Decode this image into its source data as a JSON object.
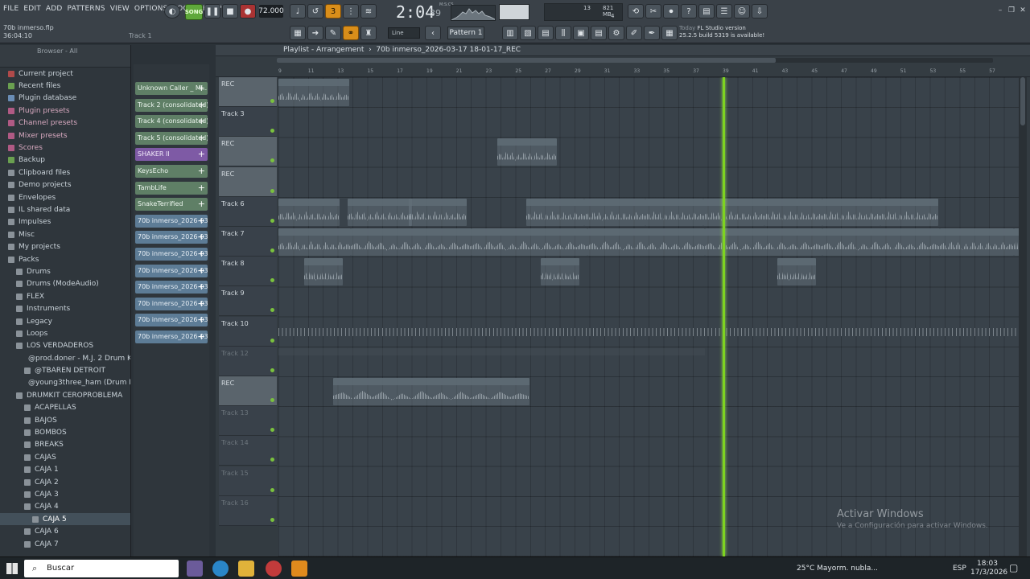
{
  "menu": [
    "FILE",
    "EDIT",
    "ADD",
    "PATTERNS",
    "VIEW",
    "OPTIONS",
    "TOOLS",
    "HELP"
  ],
  "project_file": "70b inmerso.flp",
  "project_time": "36:04:10",
  "track_hint": "Track 1",
  "song_mode": "SONG",
  "tempo": "72.000",
  "time": "2:04",
  "time_frac": "39",
  "time_unit": "M:S:CS",
  "cpu": {
    "cores": "13",
    "mem": "821 MB",
    "poly": "4"
  },
  "snap": "Line",
  "pattern": "Pattern 1",
  "news": {
    "label": "Today",
    "title": "FL Studio version",
    "body": "25.2.5 build 5319 is available!"
  },
  "browser": {
    "title": "Browser - All",
    "items": [
      {
        "label": "Current project",
        "kind": "red",
        "indent": 0
      },
      {
        "label": "Recent files",
        "kind": "green",
        "indent": 0
      },
      {
        "label": "Plugin database",
        "kind": "blue",
        "indent": 0
      },
      {
        "label": "Plugin presets",
        "kind": "pink",
        "indent": 0
      },
      {
        "label": "Channel presets",
        "kind": "pink",
        "indent": 0
      },
      {
        "label": "Mixer presets",
        "kind": "pink",
        "indent": 0
      },
      {
        "label": "Scores",
        "kind": "pink",
        "indent": 0
      },
      {
        "label": "Backup",
        "kind": "green",
        "indent": 0
      },
      {
        "label": "Clipboard files",
        "kind": "folder",
        "indent": 0
      },
      {
        "label": "Demo projects",
        "kind": "folder",
        "indent": 0
      },
      {
        "label": "Envelopes",
        "kind": "folder",
        "indent": 0
      },
      {
        "label": "IL shared data",
        "kind": "folder",
        "indent": 0
      },
      {
        "label": "Impulses",
        "kind": "folder",
        "indent": 0
      },
      {
        "label": "Misc",
        "kind": "folder",
        "indent": 0
      },
      {
        "label": "My projects",
        "kind": "folder",
        "indent": 0
      },
      {
        "label": "Packs",
        "kind": "folder",
        "indent": 0
      },
      {
        "label": "Drums",
        "kind": "folder",
        "indent": 1
      },
      {
        "label": "Drums (ModeAudio)",
        "kind": "folder",
        "indent": 1
      },
      {
        "label": "FLEX",
        "kind": "folder",
        "indent": 1
      },
      {
        "label": "Instruments",
        "kind": "folder",
        "indent": 1
      },
      {
        "label": "Legacy",
        "kind": "folder",
        "indent": 1
      },
      {
        "label": "Loops",
        "kind": "folder",
        "indent": 1
      },
      {
        "label": "LOS VERDADEROS",
        "kind": "folder",
        "indent": 1
      },
      {
        "label": "@prod.doner - M.J. 2 Drum Kit",
        "kind": "folder",
        "indent": 2
      },
      {
        "label": "@TBAREN DETROIT",
        "kind": "folder",
        "indent": 2
      },
      {
        "label": "@young3three_ham (Drum Kit)",
        "kind": "folder",
        "indent": 2
      },
      {
        "label": "DRUMKIT CEROPROBLEMA",
        "kind": "folder",
        "indent": 1
      },
      {
        "label": "ACAPELLAS",
        "kind": "folder",
        "indent": 2
      },
      {
        "label": "BAJOS",
        "kind": "folder",
        "indent": 2
      },
      {
        "label": "BOMBOS",
        "kind": "folder",
        "indent": 2
      },
      {
        "label": "BREAKS",
        "kind": "folder",
        "indent": 2
      },
      {
        "label": "CAJAS",
        "kind": "folder",
        "indent": 2
      },
      {
        "label": "CAJA 1",
        "kind": "folder",
        "indent": 2
      },
      {
        "label": "CAJA 2",
        "kind": "folder",
        "indent": 2
      },
      {
        "label": "CAJA 3",
        "kind": "folder",
        "indent": 2
      },
      {
        "label": "CAJA 4",
        "kind": "folder",
        "indent": 2
      },
      {
        "label": "CAJA 5",
        "kind": "folder",
        "indent": 3
      },
      {
        "label": "CAJA 6",
        "kind": "folder",
        "indent": 2
      },
      {
        "label": "CAJA 7",
        "kind": "folder",
        "indent": 2
      }
    ]
  },
  "channels": [
    {
      "label": "Unknown Caller _ Mi...",
      "color": "green"
    },
    {
      "label": "Track 2 (consolidated)",
      "color": "green"
    },
    {
      "label": "Track 4 (consolidated)",
      "color": "green"
    },
    {
      "label": "Track 5 (consolidated)",
      "color": "green"
    },
    {
      "label": "SHAKER II",
      "color": "purple"
    },
    {
      "label": "KeysEcho",
      "color": "green"
    },
    {
      "label": "TambLife",
      "color": "green"
    },
    {
      "label": "SnakeTerrified",
      "color": "green"
    },
    {
      "label": "70b inmerso_2026-03-1...",
      "color": "blue"
    },
    {
      "label": "70b inmerso_2026-03-1...",
      "color": "blue"
    },
    {
      "label": "70b inmerso_2026-03-1...",
      "color": "blue"
    },
    {
      "label": "70b inmerso_2026-03-1...",
      "color": "blue"
    },
    {
      "label": "70b inmerso_2026-03-1...",
      "color": "blue"
    },
    {
      "label": "70b inmerso_2026-03-1...",
      "color": "blue"
    },
    {
      "label": "70b inmerso_2026-03-1...",
      "color": "blue"
    },
    {
      "label": "70b inmerso_2026-03-1...",
      "color": "blue"
    }
  ],
  "playlist": {
    "title": "Playlist - Arrangement",
    "arrangement": "70b inmerso_2026-03-17 18-01-17_REC",
    "ruler": [
      "9",
      "11",
      "13",
      "15",
      "17",
      "19",
      "21",
      "23",
      "25",
      "27",
      "29",
      "31",
      "33",
      "35",
      "37",
      "39",
      "41",
      "43",
      "45",
      "47",
      "49",
      "51",
      "53",
      "55",
      "57"
    ],
    "tracks": [
      {
        "name": "REC",
        "rec": true
      },
      {
        "name": "Track 3",
        "rec": false
      },
      {
        "name": "REC",
        "rec": true
      },
      {
        "name": "REC",
        "rec": true
      },
      {
        "name": "Track 6",
        "rec": false
      },
      {
        "name": "Track 7",
        "rec": false
      },
      {
        "name": "Track 8",
        "rec": false
      },
      {
        "name": "Track 9",
        "rec": false
      },
      {
        "name": "Track 10",
        "rec": false
      },
      {
        "name": "Track 12",
        "rec": false,
        "dim": true
      },
      {
        "name": "REC",
        "rec": true
      },
      {
        "name": "Track 13",
        "rec": false,
        "dim": true
      },
      {
        "name": "Track 14",
        "rec": false,
        "dim": true
      },
      {
        "name": "Track 15",
        "rec": false,
        "dim": true
      },
      {
        "name": "Track 16",
        "rec": false,
        "dim": true
      }
    ],
    "clips": [
      {
        "label": "70b inmerso...55-03_REC",
        "row": 0
      },
      {
        "label": "70b inmerso_2026-03-17 18-01-17_REC",
        "row": 2
      },
      {
        "label": "Track 4 (...lidated)",
        "row": 4
      },
      {
        "label": "Track 4 (c...solidated)",
        "row": 4
      },
      {
        "label": "Track 4 (c...solidated)",
        "row": 4
      },
      {
        "label": "Track 4 (c...solidated)",
        "row": 4
      },
      {
        "label": "Track 4 (c...solidated)",
        "row": 4
      },
      {
        "label": "Track 4 (c...solidated)",
        "row": 4
      },
      {
        "label": "Track 4 (c...solidated)",
        "row": 4
      },
      {
        "label": "Track 4 (c...solidated)",
        "row": 4
      },
      {
        "label": "Track 4 (c...solidated)",
        "row": 4
      },
      {
        "label": "Track 4 (c...solidated)",
        "row": 4
      },
      {
        "label": "Track 5 (consolidated)",
        "row": 5
      },
      {
        "label": "Track 5 (consolidated)",
        "row": 5
      },
      {
        "label": "Track 5 (consolidated)",
        "row": 5
      },
      {
        "label": "Track 5 (consolidated)",
        "row": 5
      },
      {
        "label": "Track 5 (consolidated)",
        "row": 5
      },
      {
        "label": "Track 5 (consolidated)",
        "row": 5
      },
      {
        "label": "Track 5 (consolidated)",
        "row": 5
      },
      {
        "label": "Track 5 (consolidated)",
        "row": 5
      },
      {
        "label": "Ke...ho",
        "row": 6
      },
      {
        "label": "Ke...ho",
        "row": 6
      },
      {
        "label": "Ke...ho",
        "row": 6
      },
      {
        "label": "Pattern 1",
        "row": 9
      },
      {
        "label": "Pattern 1",
        "row": 9
      },
      {
        "label": "Pattern 1",
        "row": 9
      },
      {
        "label": "Pattern 1",
        "row": 9
      },
      {
        "label": "70b inmerso_2026-03-17 17-59-59_REC",
        "row": 10
      }
    ]
  },
  "overlay": {
    "title": "Activar Windows",
    "sub": "Ve a Configuración para activar Windows."
  },
  "taskbar": {
    "search": "Buscar",
    "weather": "25°C  Mayorm. nubla...",
    "lang": "ESP",
    "clock_time": "18:03",
    "clock_date": "17/3/2026"
  }
}
